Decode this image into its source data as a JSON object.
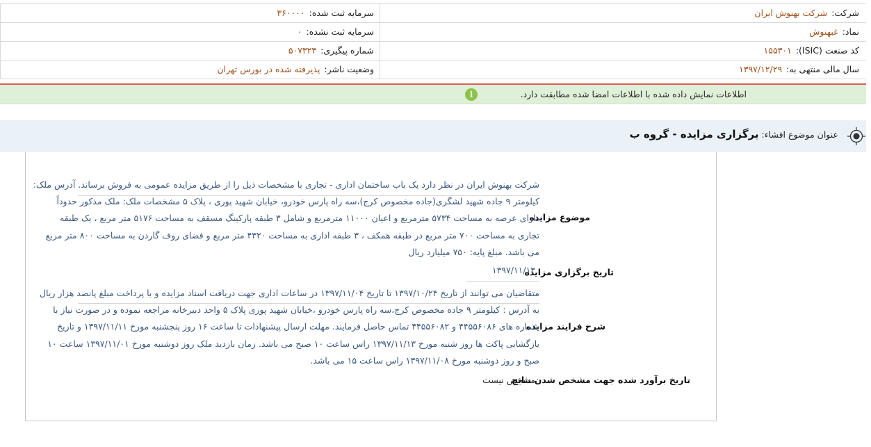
{
  "company": {
    "company_label": "شرکت:",
    "company_value": "شرکت بهنوش ایران",
    "symbol_label": "نماد:",
    "symbol_value": "غبهنوش",
    "isic_label": "کد صنعت (ISIC):",
    "isic_value": "۱۵۵۳۰۱",
    "fiscal_label": "سال مالی منتهی به:",
    "fiscal_value": "۱۳۹۷/۱۲/۲۹",
    "registered_capital_label": "سرمایه ثبت شده:",
    "registered_capital_value": "۳۶۰۰۰۰",
    "unregistered_capital_label": "سرمایه ثبت نشده:",
    "unregistered_capital_value": "۰",
    "tracking_label": "شماره پیگیری:",
    "tracking_value": "۵۰۷۳۲۳",
    "publisher_status_label": "وضعیت ناشر:",
    "publisher_status_value": "پذیرفته شده در بورس تهران"
  },
  "notice": {
    "text": "اطلاعات نمایش داده شده با اطلاعات امضا شده مطابقت دارد.",
    "icon": "info-icon",
    "color": "#8bc34a"
  },
  "disclosure": {
    "title_label": "عنوان موضوع افشاء:",
    "title_value": "برگزاری مزایده - گروه ب",
    "icon": "target-icon"
  },
  "fields": {
    "subject_label": "موضوع مزایده",
    "subject_lines": [
      "شرکت بهنوش ایران در نظر دارد یک باب ساختمان اداری - تجاری با مشخصات ذیل را از طریق مزایده عمومی به فروش برساند. آدرس ملک:",
      "کیلومتر ۹ جاده شهید لشگری(جاده مخصوص کرج)،سه راه پارس خودرو، خیابان شهید پوری ، پلاک ۵ مشخصات ملک: ملک مذکور حدوداً",
      "دارای عرصه به مساحت ۵۷۳۴ مترمربع و اعیان ۱۱۰۰۰ مترمربع و شامل ۳ طبقه پارکینگ مسقف به مساحت ۵۱۷۶ متر مربع ، یک طبقه",
      "تجاری به مساحت ۷۰۰ متر مربع در طبقه همکف ، ۳ طبقه اداری به مساحت ۴۳۲۰ متر مربع و فضای روف گاردن به مساحت ۸۰۰ متر مربع",
      "می باشد. مبلغ پایه: ۷۵۰ میلیارد ریال"
    ],
    "auction_date_label": "تاریخ برگزاری مزایده",
    "auction_date_value": "۱۳۹۷/۱۱/۱۳",
    "process_label": "شرح فرایند مزایده",
    "process_lines": [
      "متقاضیان می توانند از تاریخ ۱۳۹۷/۱۰/۲۴ تا تاریخ ۱۳۹۷/۱۱/۰۴ در ساعات اداری جهت دریافت اسناد مزایده و با پرداخت مبلغ پانصد هزار ریال",
      "به آدرس : کیلومتر ۹ جاده مخصوص کرج،سه راه پارس خودرو ،خیابان شهید پوری پلاک ۵ واحد دبیرخانه مراجعه نموده و در صورت نیاز با",
      "شماره های ۴۴۵۵۶۰۸۶ و ۴۴۵۵۶۰۸۲ تماس حاصل فرمایند. مهلت ارسال پیشنهادات تا ساعت ۱۶ روز پنجشنبه مورخ ۱۳۹۷/۱۱/۱۱ و تاریخ",
      "بازگشایی پاکت ها روز شنبه مورخ ۱۳۹۷/۱۱/۱۳ راس ساعت ۱۰ صبح می باشد. زمان بازدید ملک روز دوشنبه مورخ ۱۳۹۷/۱۱/۰۱ ساعت ۱۰",
      "صبح و روز دوشنبه مورخ ۱۳۹۷/۱۱/۰۸ راس ساعت ۱۵ می باشد."
    ],
    "results_date_label": "تاریخ برآورد شده جهت مشخص شدن نتایج",
    "results_date_value": "مشخص نیست"
  }
}
